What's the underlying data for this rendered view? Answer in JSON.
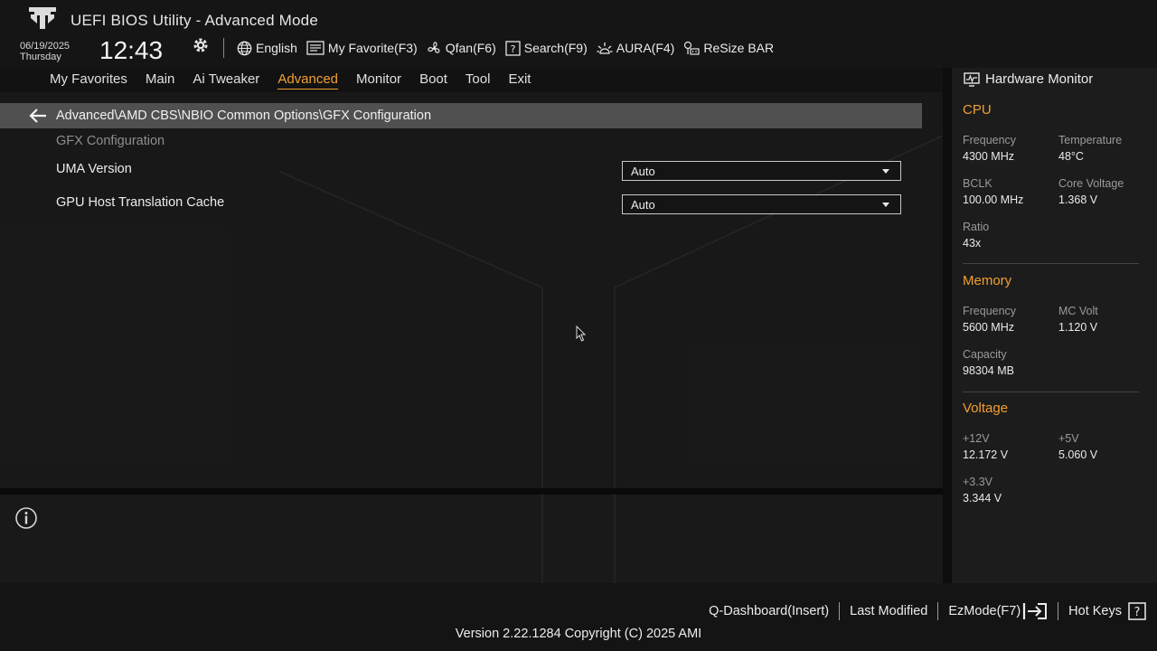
{
  "header": {
    "title": "UEFI BIOS Utility - Advanced Mode",
    "date": "06/19/2025",
    "day": "Thursday",
    "time": "12:43",
    "toolbar": {
      "language": "English",
      "favorite": "My Favorite(F3)",
      "qfan": "Qfan(F6)",
      "search": "Search(F9)",
      "aura": "AURA(F4)",
      "resize_bar": "ReSize BAR"
    }
  },
  "menu": {
    "favorites": "My Favorites",
    "main": "Main",
    "ai_tweaker": "Ai Tweaker",
    "advanced": "Advanced",
    "monitor": "Monitor",
    "boot": "Boot",
    "tool": "Tool",
    "exit": "Exit",
    "active": "Advanced"
  },
  "content": {
    "breadcrumb": "Advanced\\AMD CBS\\NBIO Common Options\\GFX Configuration",
    "section_title": "GFX Configuration",
    "settings": [
      {
        "label": "UMA Version",
        "value": "Auto"
      },
      {
        "label": "GPU Host Translation Cache",
        "value": "Auto"
      }
    ]
  },
  "hardware_monitor": {
    "title": "Hardware Monitor",
    "cpu": {
      "heading": "CPU",
      "frequency_label": "Frequency",
      "frequency": "4300 MHz",
      "temperature_label": "Temperature",
      "temperature": "48°C",
      "bclk_label": "BCLK",
      "bclk": "100.00 MHz",
      "core_voltage_label": "Core Voltage",
      "core_voltage": "1.368 V",
      "ratio_label": "Ratio",
      "ratio": "43x"
    },
    "memory": {
      "heading": "Memory",
      "frequency_label": "Frequency",
      "frequency": "5600 MHz",
      "mc_volt_label": "MC Volt",
      "mc_volt": "1.120 V",
      "capacity_label": "Capacity",
      "capacity": "98304 MB"
    },
    "voltage": {
      "heading": "Voltage",
      "v12_label": "+12V",
      "v12": "12.172 V",
      "v5_label": "+5V",
      "v5": "5.060 V",
      "v33_label": "+3.3V",
      "v33": "3.344 V"
    }
  },
  "footer": {
    "qdashboard": "Q-Dashboard(Insert)",
    "last_modified": "Last Modified",
    "ezmode": "EzMode(F7)",
    "hotkeys": "Hot Keys",
    "version": "Version 2.22.1284 Copyright (C) 2025 AMI"
  },
  "colors": {
    "accent": "#f0a032",
    "background": "#121212",
    "breadcrumb_bar": "#505050"
  }
}
